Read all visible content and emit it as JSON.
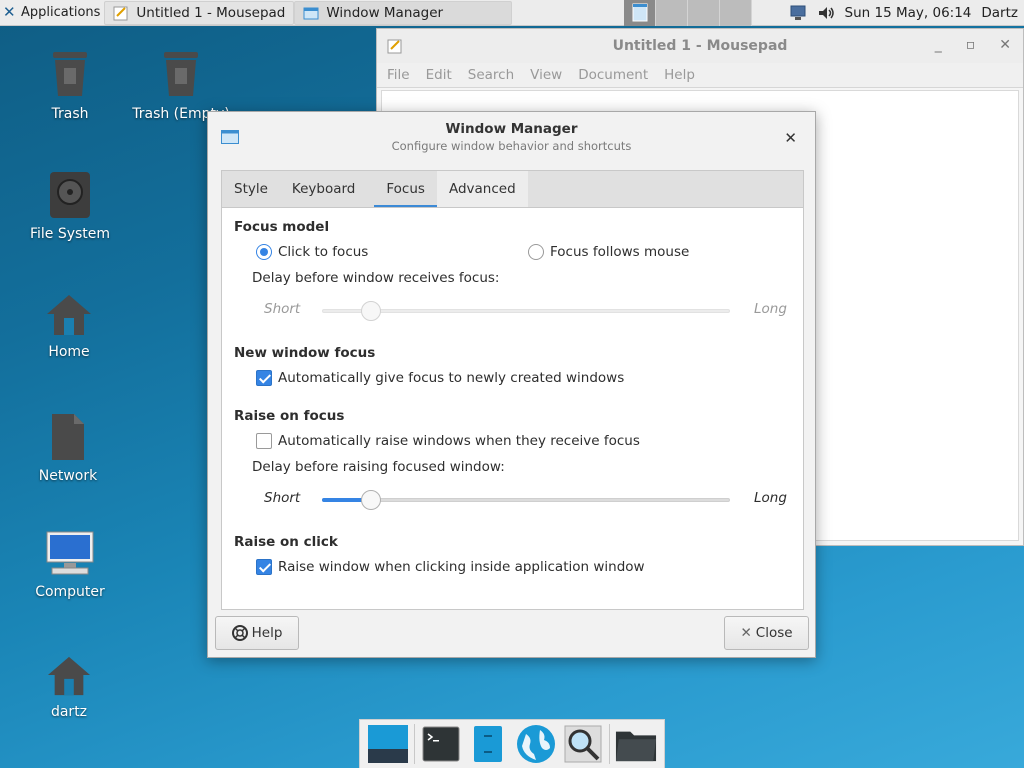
{
  "top_panel": {
    "applications_label": "Applications",
    "tasks": [
      {
        "label": "Untitled 1 - Mousepad"
      },
      {
        "label": "Window Manager"
      }
    ],
    "datetime": "Sun 15 May, 06:14",
    "user": "Dartz"
  },
  "desktop_icons": [
    {
      "label": "Trash"
    },
    {
      "label": "Trash (Empty)"
    },
    {
      "label": "File System"
    },
    {
      "label": "Home"
    },
    {
      "label": "Network"
    },
    {
      "label": "Computer"
    },
    {
      "label": "dartz"
    }
  ],
  "mousepad": {
    "title": "Untitled 1 - Mousepad",
    "menu": [
      "File",
      "Edit",
      "Search",
      "View",
      "Document",
      "Help"
    ]
  },
  "dialog": {
    "title": "Window Manager",
    "subtitle": "Configure window behavior and shortcuts",
    "tabs": [
      "Style",
      "Keyboard",
      "Focus",
      "Advanced"
    ],
    "selected_tab": "Focus",
    "focus_model": {
      "heading": "Focus model",
      "click_to_focus": "Click to focus",
      "follows_mouse": "Focus follows mouse",
      "selected": "click_to_focus",
      "delay_label": "Delay before window receives focus:",
      "short": "Short",
      "long": "Long",
      "delay_value": 0.12,
      "enabled": false
    },
    "new_window_focus": {
      "heading": "New window focus",
      "option": "Automatically give focus to newly created windows",
      "checked": true
    },
    "raise_on_focus": {
      "heading": "Raise on focus",
      "option": "Automatically raise windows when they receive focus",
      "checked": false,
      "delay_label": "Delay before raising focused window:",
      "short": "Short",
      "long": "Long",
      "delay_value": 0.12
    },
    "raise_on_click": {
      "heading": "Raise on click",
      "option": "Raise window when clicking inside application window",
      "checked": true
    },
    "help_button": "Help",
    "close_button": "Close"
  },
  "colors": {
    "accent": "#3584e4",
    "desktop": "#1a85b6"
  }
}
